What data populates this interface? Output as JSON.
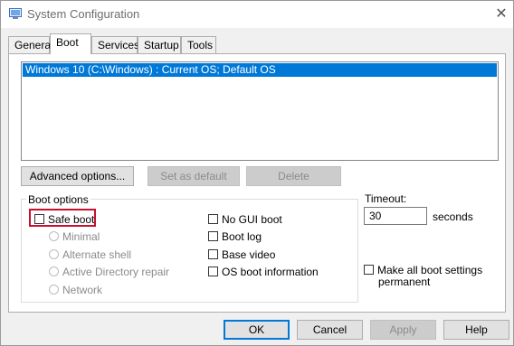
{
  "window": {
    "title": "System Configuration"
  },
  "tabs": [
    {
      "label": "General"
    },
    {
      "label": "Boot"
    },
    {
      "label": "Services"
    },
    {
      "label": "Startup"
    },
    {
      "label": "Tools"
    }
  ],
  "active_tab": "Boot",
  "os_list": {
    "items": [
      "Windows 10 (C:\\Windows) : Current OS; Default OS"
    ],
    "selected": 0
  },
  "os_buttons": {
    "advanced": "Advanced options...",
    "set_default": "Set as default",
    "delete": "Delete"
  },
  "boot_options": {
    "label": "Boot options",
    "safe_boot": {
      "label": "Safe boot",
      "checked": false
    },
    "modes": [
      "Minimal",
      "Alternate shell",
      "Active Directory repair",
      "Network"
    ],
    "no_gui_boot": {
      "label": "No GUI boot",
      "checked": false
    },
    "boot_log": {
      "label": "Boot log",
      "checked": false
    },
    "base_video": {
      "label": "Base video",
      "checked": false
    },
    "os_boot_info": {
      "label": "OS boot information",
      "checked": false
    }
  },
  "timeout": {
    "label": "Timeout:",
    "value": "30",
    "unit": "seconds"
  },
  "permanent": {
    "label_line1": "Make all boot settings",
    "label_line2": "permanent",
    "checked": false
  },
  "footer": {
    "ok": "OK",
    "cancel": "Cancel",
    "apply": "Apply",
    "help": "Help"
  },
  "colors": {
    "selection": "#0078d7",
    "highlight_box": "#c8102e"
  },
  "icons": {
    "app": "msconfig-icon",
    "close": "close-icon"
  }
}
